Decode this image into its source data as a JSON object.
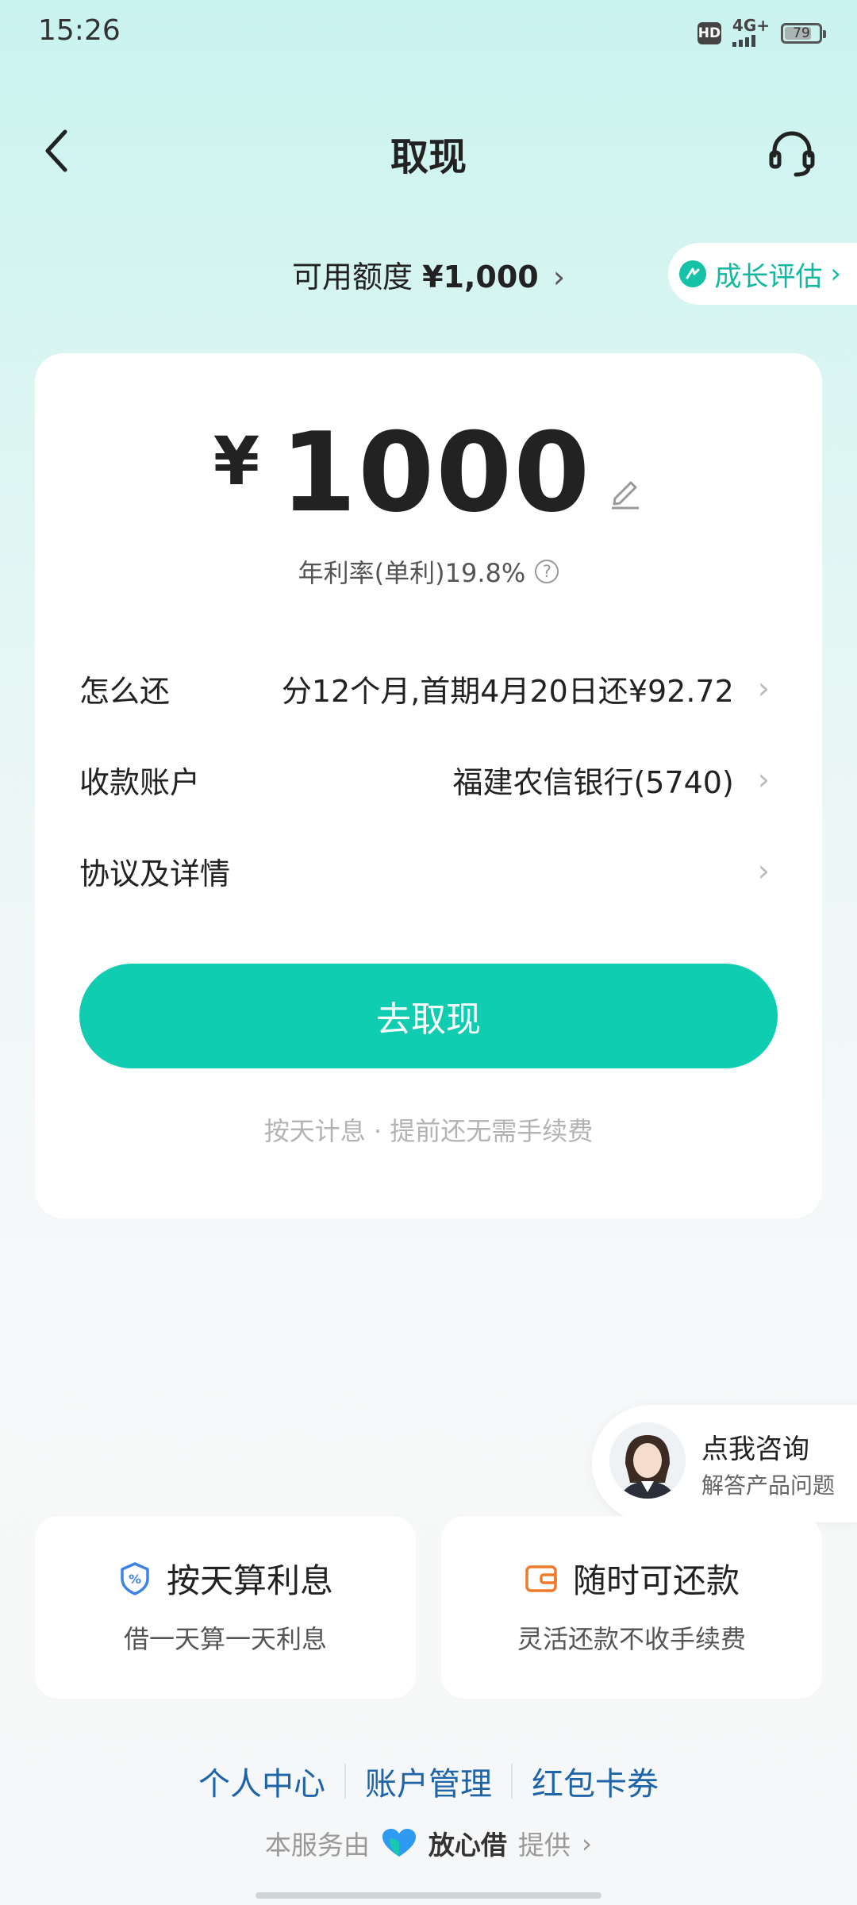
{
  "status_bar": {
    "time": "15:26",
    "hd": "HD",
    "network": "4G+",
    "battery": "79",
    "battery_level": 79
  },
  "header": {
    "title": "取现"
  },
  "credit": {
    "label": "可用额度",
    "amount": "¥1,000",
    "growth_label": "成长评估"
  },
  "loan": {
    "currency": "¥",
    "amount": "1000",
    "rate_text": "年利率(单利)19.8%",
    "rows": [
      {
        "label": "怎么还",
        "value": "分12个月,首期4月20日还¥92.72"
      },
      {
        "label": "收款账户",
        "value": "福建农信银行(5740)"
      },
      {
        "label": "协议及详情",
        "value": ""
      }
    ],
    "cta_label": "去取现",
    "note": "按天计息 · 提前还无需手续费"
  },
  "consult": {
    "title": "点我咨询",
    "subtitle": "解答产品问题"
  },
  "features": [
    {
      "title": "按天算利息",
      "subtitle": "借一天算一天利息",
      "icon": "percent-shield-icon",
      "color": "#3f82e6"
    },
    {
      "title": "随时可还款",
      "subtitle": "灵活还款不收手续费",
      "icon": "wallet-icon",
      "color": "#f07a2b"
    }
  ],
  "footer": {
    "links": [
      "个人中心",
      "账户管理",
      "红包卡券"
    ],
    "provider_prefix": "本服务由",
    "provider_brand": "放心借",
    "provider_suffix": "提供"
  },
  "colors": {
    "accent": "#10cdb1",
    "link": "#1d64a8"
  }
}
